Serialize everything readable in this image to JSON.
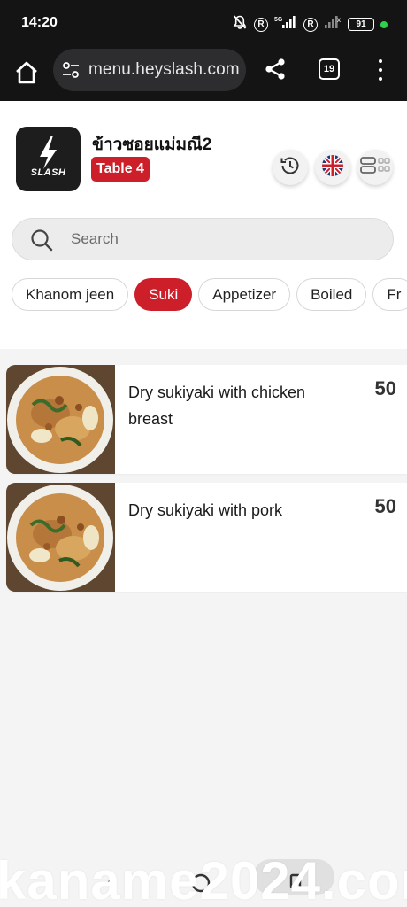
{
  "status_bar": {
    "time": "14:20",
    "network": "5G",
    "roaming_badge": "R",
    "battery": "91"
  },
  "browser": {
    "url": "menu.heyslash.com",
    "tab_count": "19"
  },
  "header": {
    "logo_text": "SLASH",
    "shop_name": "ข้าวซอยแม่มณี2",
    "table_label": "Table 4"
  },
  "search": {
    "placeholder": "Search",
    "value": ""
  },
  "categories": [
    "Khanom jeen",
    "Suki",
    "Appetizer",
    "Boiled",
    "Fr"
  ],
  "active_category": "Suki",
  "items": [
    {
      "name": "Dry sukiyaki with chicken breast",
      "price": "50"
    },
    {
      "name": "Dry sukiyaki with pork",
      "price": "50"
    }
  ],
  "watermark": "kaname2024.com",
  "colors": {
    "accent": "#cc1f2a",
    "toolbar": "#141414"
  }
}
